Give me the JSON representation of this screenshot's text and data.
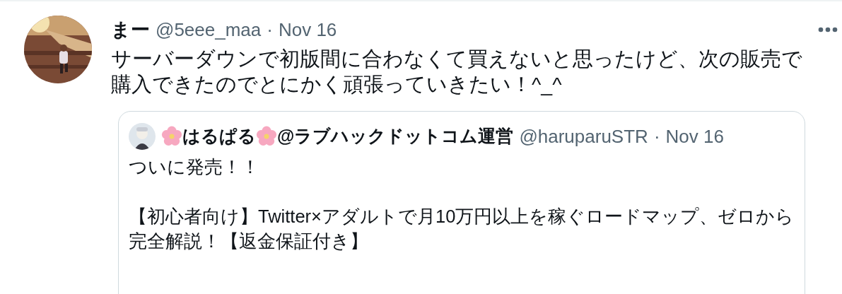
{
  "tweet": {
    "author_name": "まー",
    "handle": "@5eee_maa",
    "separator": "·",
    "date": "Nov 16",
    "text": "サーバーダウンで初版間に合わなくて買えないと思ったけど、次の販売で購入できたのでとにかく頑張っていきたい！^_^",
    "quote": {
      "author_name": "はるぱる",
      "author_suffix": "@ラブハックドットコム運営",
      "handle": "@haruparuSTR",
      "separator": "·",
      "date": "Nov 16",
      "paragraphs": [
        "ついに発売！！",
        "【初心者向け】Twitter×アダルトで月10万円以上を稼ぐロードマップ、ゼロから完全解説！【返金保証付き】"
      ]
    }
  }
}
